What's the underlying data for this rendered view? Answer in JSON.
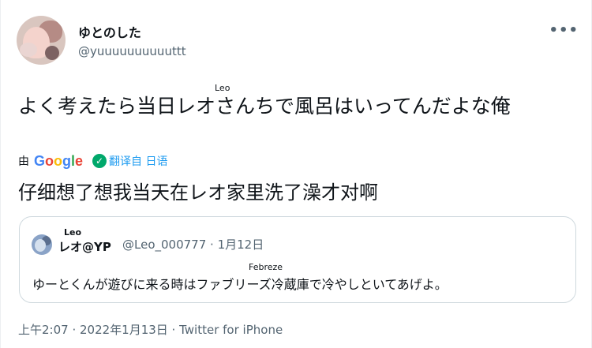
{
  "author": {
    "display_name": "ゆとのした",
    "handle": "@yuuuuuuuuuuttt",
    "more_icon": "more-horizontal-icon"
  },
  "tweet": {
    "ruby": "Leo",
    "text": "よく考えたら当日レオさんちで風呂はいってんだよな俺"
  },
  "translation": {
    "by_label": "由",
    "provider": "Google",
    "translated_from": "翻译自 日语",
    "text": "仔细想了想我当天在レオ家里洗了澡才对啊"
  },
  "quoted": {
    "ruby": "Leo",
    "name": "レオ@YP",
    "meta": "@Leo_000777 · 1月12日",
    "ruby_text": "Febreze",
    "text": "ゆーとくんが遊びに来る時はファブリーズ冷蔵庫で冷やしといてあげよ。"
  },
  "footer": {
    "timestamp": "上午2:07 · 2022年1月13日 · ",
    "source": "Twitter for iPhone"
  },
  "colors": {
    "text": "#0f1419",
    "secondary": "#536471",
    "link": "#1d9bf0",
    "border": "#cfd9de"
  }
}
